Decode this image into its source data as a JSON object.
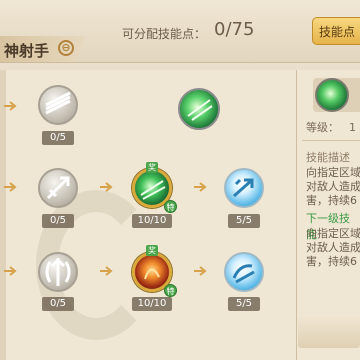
{
  "header": {
    "class_name": "神射手",
    "points_label": "可分配技能点：",
    "points_value": "0/75",
    "points_button_label": "技能点"
  },
  "tree": {
    "rows": [
      {
        "nodes": [
          {
            "count": "0/5",
            "style": "gray"
          },
          {
            "count": "",
            "style": "green-big"
          }
        ]
      },
      {
        "nodes": [
          {
            "count": "0/5",
            "style": "gray"
          },
          {
            "count": "10/10",
            "style": "green",
            "badge_top": "奖",
            "badge_bottom": "特"
          },
          {
            "count": "5/5",
            "style": "blue"
          }
        ]
      },
      {
        "nodes": [
          {
            "count": "0/5",
            "style": "gray"
          },
          {
            "count": "10/10",
            "style": "fire",
            "badge_top": "奖",
            "badge_bottom": "特"
          },
          {
            "count": "5/5",
            "style": "blue"
          }
        ]
      }
    ]
  },
  "detail": {
    "level_label": "等级：",
    "level_value": "1",
    "desc_title": "技能描述",
    "desc_lines": [
      "向指定区域",
      "对敌人造成",
      "害，持续6"
    ],
    "next_title": "下一级技能",
    "next_lines": [
      "向指定区域",
      "对敌人造成",
      "害，持续6"
    ]
  },
  "colors": {
    "background": "#e9dfcc",
    "accent_gold": "#d9a93a",
    "badge_green": "#4aa44a",
    "text_brown": "#6c5d4a"
  }
}
